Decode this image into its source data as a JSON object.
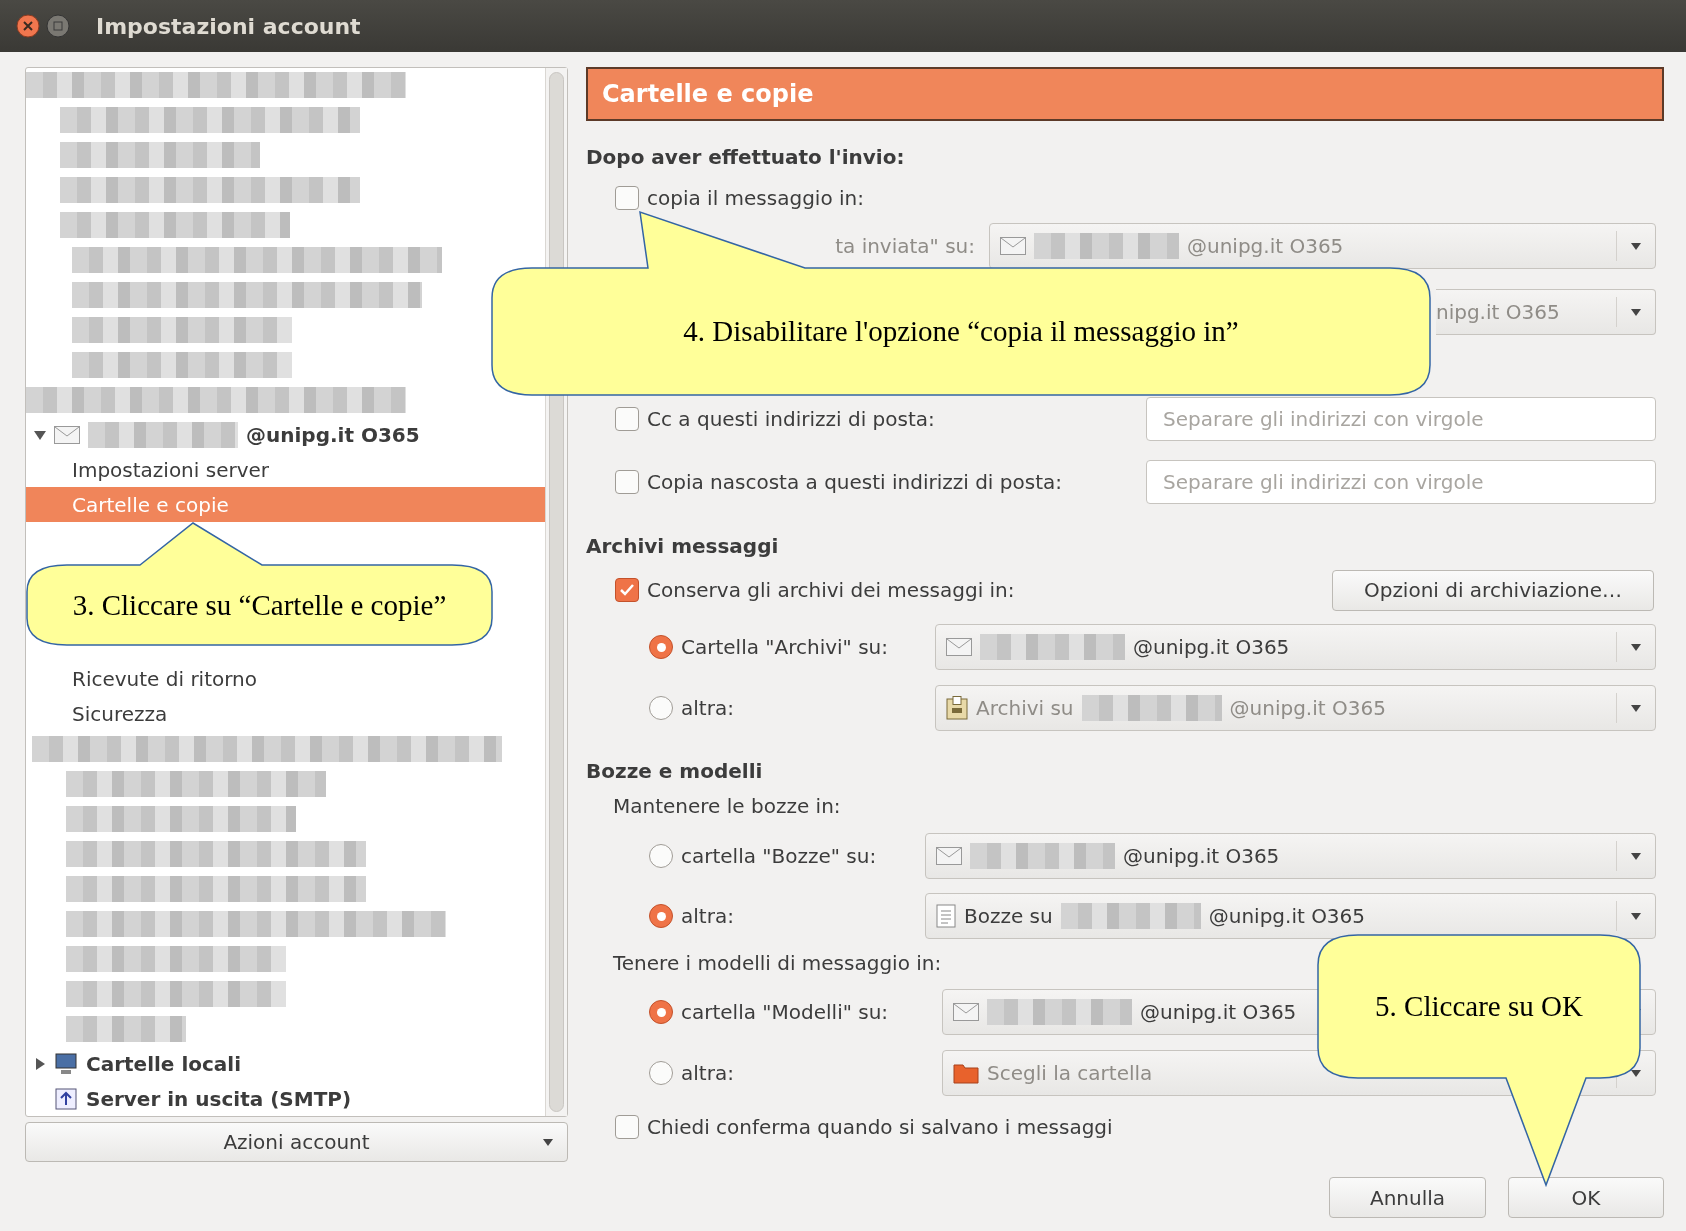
{
  "window": {
    "title": "Impostazioni account"
  },
  "sidebar": {
    "tree": [
      {
        "kind": "account",
        "label": "@unipg.it O365",
        "expanded": true,
        "children": [
          {
            "label": "Impostazioni server",
            "selected": false
          },
          {
            "label": "Cartelle e copie",
            "selected": true
          },
          {
            "label": "Ricevute di ritorno",
            "selected": false
          },
          {
            "label": "Sicurezza",
            "selected": false
          }
        ]
      },
      {
        "kind": "local",
        "label": "Cartelle locali",
        "expanded": false
      },
      {
        "kind": "smtp",
        "label": "Server in uscita (SMTP)"
      }
    ],
    "actions_button": "Azioni account"
  },
  "panel": {
    "title": "Cartelle e copie",
    "sent": {
      "heading": "Dopo aver effettuato l'invio:",
      "copy": {
        "label": "copia il messaggio in:",
        "checked": false
      },
      "targets": [
        {
          "label": "ta inviata\" su:",
          "kind": "account",
          "redacted": true,
          "value": "@unipg.it O365",
          "disabled": true
        },
        {
          "value": "nipg.it O365",
          "disabled": true
        }
      ],
      "cc": {
        "label": "Cc a questi indirizzi di posta:",
        "checked": false,
        "placeholder": "Separare gli indirizzi con virgole"
      },
      "bcc": {
        "label": "Copia nascosta a questi indirizzi di posta:",
        "checked": false,
        "placeholder": "Separare gli indirizzi con virgole"
      }
    },
    "archives": {
      "heading": "Archivi messaggi",
      "keep": {
        "label": "Conserva gli archivi dei messaggi in:",
        "checked": true
      },
      "options_button": "Opzioni di archiviazione…",
      "choices": [
        {
          "label": "Cartella \"Archivi\" su:",
          "selected": true,
          "kind": "account",
          "redacted": true,
          "value": "@unipg.it O365",
          "disabled": false
        },
        {
          "label": "altra:",
          "selected": false,
          "kind": "archive",
          "prefix": "Archivi su",
          "redacted": true,
          "value": "@unipg.it O365",
          "disabled": true
        }
      ]
    },
    "drafts": {
      "heading": "Bozze e modelli",
      "drafts_label": "Mantenere le bozze in:",
      "draft_choices": [
        {
          "label": "cartella \"Bozze\" su:",
          "selected": false,
          "kind": "account",
          "redacted": true,
          "value": "@unipg.it O365",
          "disabled": false
        },
        {
          "label": "altra:",
          "selected": true,
          "kind": "document",
          "prefix": "Bozze su",
          "redacted": true,
          "value": "@unipg.it O365",
          "disabled": false
        }
      ],
      "templates_label": "Tenere i modelli di messaggio in:",
      "template_choices": [
        {
          "label": "cartella \"Modelli\" su:",
          "selected": true,
          "kind": "account",
          "redacted": true,
          "value": "@unipg.it O365",
          "disabled": false
        },
        {
          "label": "altra:",
          "selected": false,
          "kind": "folder",
          "value": "Scegli la cartella",
          "disabled": true
        }
      ]
    },
    "confirm": {
      "label": "Chiedi conferma quando si salvano i messaggi",
      "checked": false
    }
  },
  "buttons": [
    "Annulla",
    "OK"
  ],
  "callouts": [
    {
      "text": "4. Disabilitare l'opzione “copia il messaggio in”"
    },
    {
      "text": "3. Cliccare su “Cartelle e copie”"
    },
    {
      "text": "5. Cliccare su OK"
    }
  ]
}
